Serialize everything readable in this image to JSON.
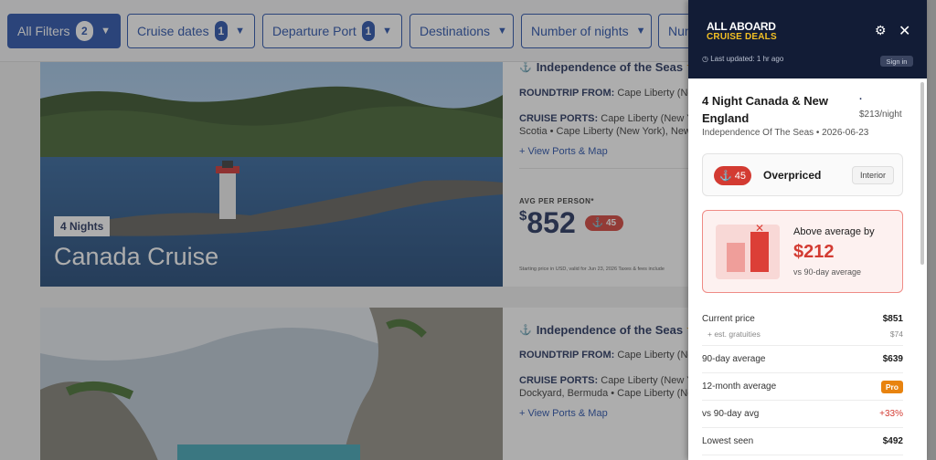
{
  "filters": [
    {
      "label": "All Filters",
      "badge": "2"
    },
    {
      "label": "Cruise dates",
      "badge": "1"
    },
    {
      "label": "Departure Port",
      "badge": "1"
    },
    {
      "label": "Destinations",
      "badge": ""
    },
    {
      "label": "Number of nights",
      "badge": ""
    },
    {
      "label": "Num",
      "badge": ""
    }
  ],
  "cards": [
    {
      "nights": "4 Nights",
      "name": "Canada Cruise",
      "ship": "Independence of the Seas",
      "stars": "★★",
      "roundtrip_label": "ROUNDTRIP FROM:",
      "roundtrip_value": "Cape Liberty (New",
      "ports_label": "CRUISE PORTS:",
      "ports_line1": "Cape Liberty (New York",
      "ports_line2": "Scotia • Cape Liberty (New York), New",
      "ports_link": "+ View Ports & Map",
      "avg_label": "AVG PER PERSON*",
      "price_dollar": "$",
      "price": "852",
      "score": "45",
      "fine_print": "Starting price in USD, valid for Jun 23, 2026 Taxes & fees include"
    },
    {
      "ship": "Independence of the Seas",
      "stars": "★★",
      "roundtrip_label": "ROUNDTRIP FROM:",
      "roundtrip_value": "Cape Liberty (New",
      "ports_label": "CRUISE PORTS:",
      "ports_line1": "Cape Liberty (New Yo",
      "ports_line2": "Dockyard, Bermuda • Cape Liberty (Ne",
      "ports_link": "+ View Ports & Map"
    }
  ],
  "panel": {
    "logo_line1": "ALL ABOARD",
    "logo_line2": "CRUISE DEALS",
    "updated": "Last updated: 1 hr ago",
    "sign_in": "Sign in",
    "title": "4 Night Canada & New England",
    "price_dot": ".",
    "per_night": "$213/night",
    "ship_date": "Independence Of The Seas • 2026-06-23",
    "rating_score": "45",
    "rating_label": "Overpriced",
    "cabin": "Interior",
    "above_label": "Above average by",
    "above_amount": "$212",
    "above_sub": "vs 90-day average",
    "stats": {
      "current_label": "Current price",
      "current_value": "$851",
      "gratuities_label": "+ est. gratuities",
      "gratuities_value": "$74",
      "avg90_label": "90-day average",
      "avg90_value": "$639",
      "avg12_label": "12-month average",
      "avg12_value": "Pro",
      "vs90_label": "vs 90-day avg",
      "vs90_value": "+33%",
      "lowest_label": "Lowest seen",
      "lowest_value": "$492"
    }
  }
}
